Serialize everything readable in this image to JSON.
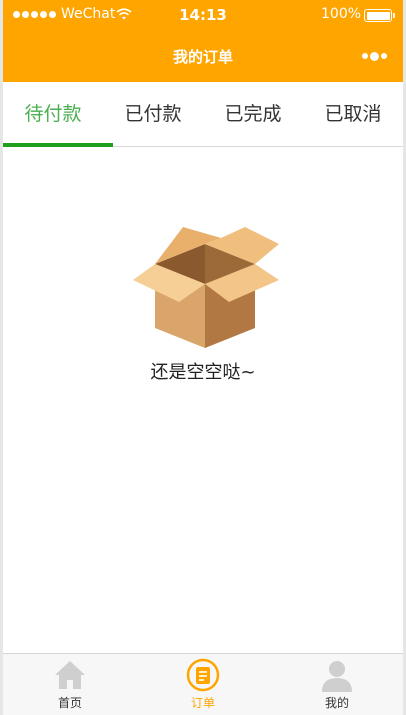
{
  "status_bar": {
    "carrier": "WeChat",
    "time": "14:13",
    "battery": "100%"
  },
  "nav": {
    "title": "我的订单",
    "menu_icon": "more-dots-icon"
  },
  "tabs": [
    {
      "label": "待付款",
      "active": true
    },
    {
      "label": "已付款",
      "active": false
    },
    {
      "label": "已完成",
      "active": false
    },
    {
      "label": "已取消",
      "active": false
    }
  ],
  "empty_state": {
    "icon": "open-box-icon",
    "text": "还是空空哒~"
  },
  "tabbar": {
    "items": [
      {
        "label": "首页",
        "icon": "home-icon",
        "active": false
      },
      {
        "label": "订单",
        "icon": "order-icon",
        "active": true
      },
      {
        "label": "我的",
        "icon": "profile-icon",
        "active": false
      }
    ]
  },
  "colors": {
    "brand": "#FFA500",
    "active_tab": "#4CAF50",
    "active_underline": "#1EA01E"
  }
}
